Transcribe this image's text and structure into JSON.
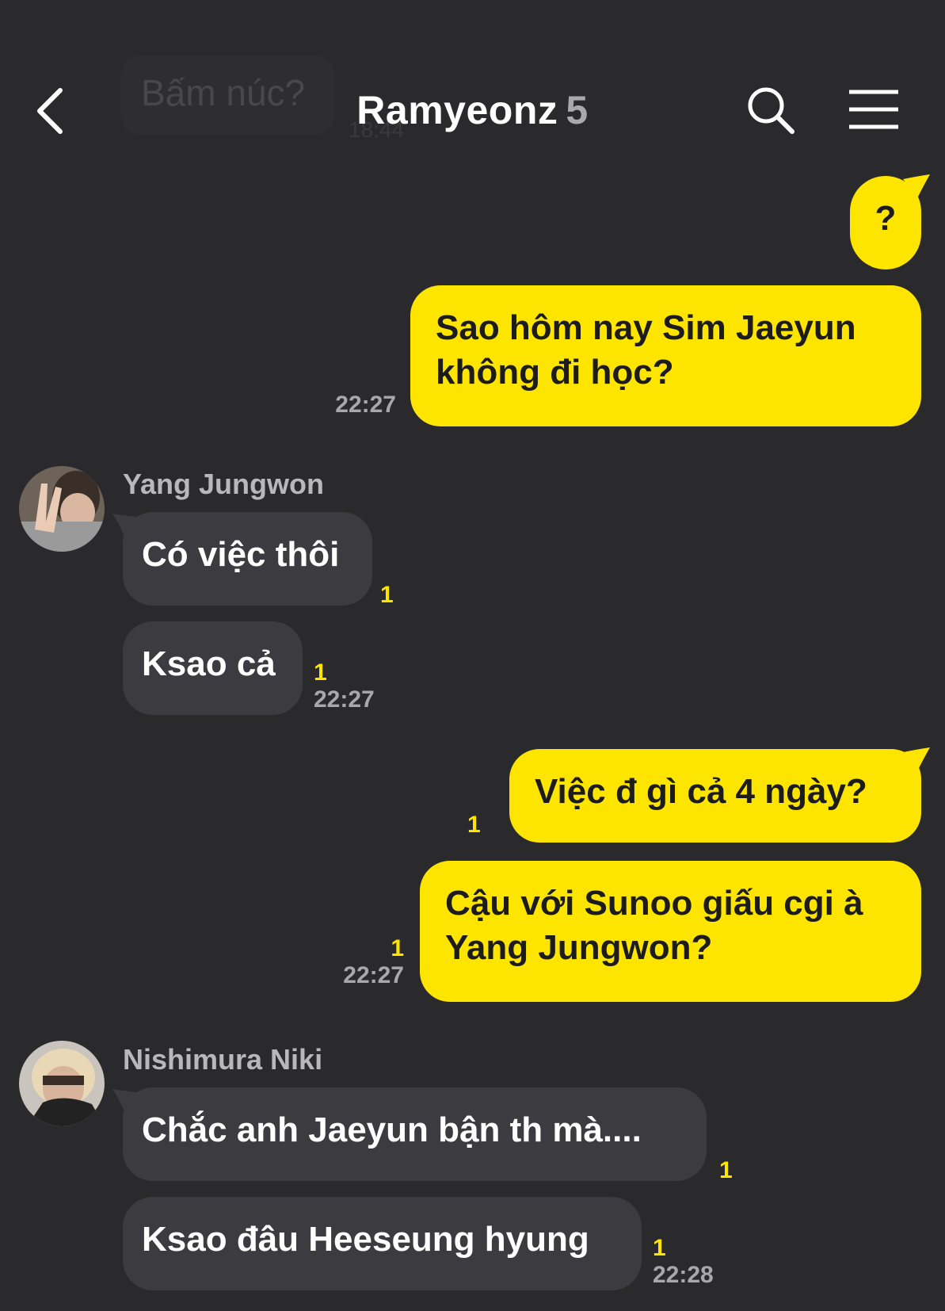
{
  "ghost": {
    "text": "Bấm núc?",
    "time": "18:44"
  },
  "header": {
    "title": "Ramyeonz",
    "member_count": "5",
    "back_icon": "chevron-left-icon",
    "search_icon": "search-icon",
    "menu_icon": "hamburger-menu-icon"
  },
  "messages": {
    "m1": {
      "text": "?"
    },
    "m2": {
      "line1": "Sao hôm nay Sim Jaeyun",
      "line2": "không đi học?",
      "time": "22:27"
    },
    "jw": {
      "sender": "Yang Jungwon"
    },
    "m3": {
      "text": "Có việc thôi",
      "unread": "1"
    },
    "m4": {
      "text": "Ksao cả",
      "unread": "1",
      "time": "22:27"
    },
    "m5": {
      "text": "Việc đ gì cả 4 ngày?",
      "unread": "1"
    },
    "m6": {
      "line1": "Cậu với Sunoo giấu cgi à",
      "line2": "Yang Jungwon?",
      "unread": "1",
      "time": "22:27"
    },
    "nk": {
      "sender": "Nishimura Niki"
    },
    "m7": {
      "text": "Chắc anh Jaeyun bận th mà....",
      "unread": "1"
    },
    "m8": {
      "text": "Ksao đâu Heeseung hyung",
      "unread": "1",
      "time": "22:28"
    }
  },
  "colors": {
    "background": "#2a2a2d",
    "outgoing_bubble": "#fee500",
    "incoming_bubble": "#3c3c40",
    "unread_count": "#fee500"
  }
}
